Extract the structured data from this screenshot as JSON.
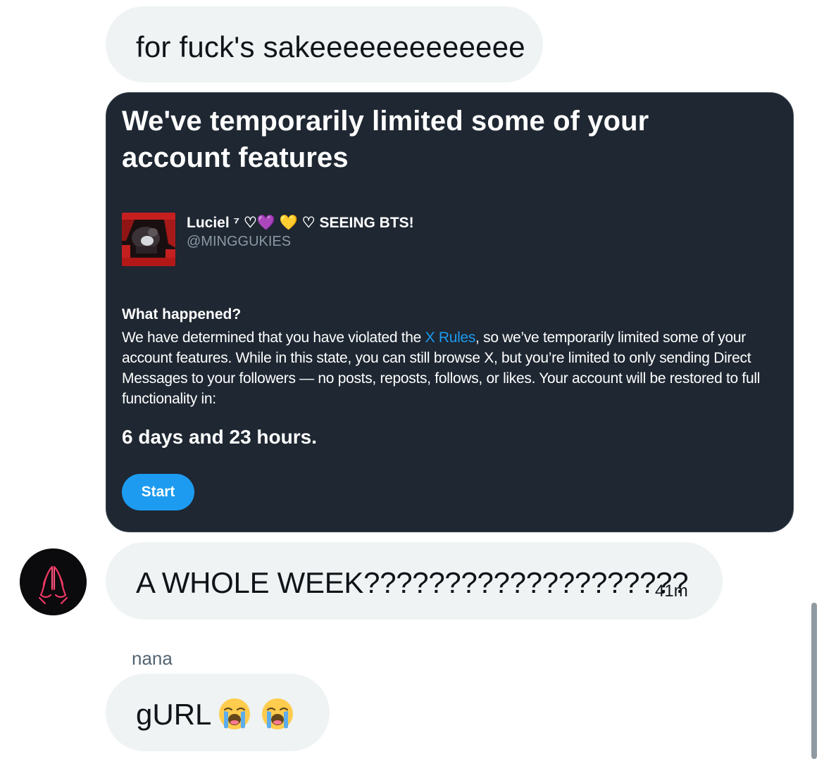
{
  "messages": {
    "first": {
      "text": "for fuck's sakeeeeeeeeeeeee"
    },
    "second": {
      "text": "A WHOLE WEEK????????????????????",
      "timestamp": "41m"
    },
    "third": {
      "sender": "nana",
      "text": "gURL",
      "emoji": "loudly-crying-face"
    }
  },
  "card": {
    "title": "We've temporarily limited some of your account features",
    "profile": {
      "display_name": "Luciel ⁷ ♡💜 💛 ♡ SEEING BTS!",
      "handle": "@MINGGUKIES"
    },
    "what_happened_heading": "What happened?",
    "body_before_link": "We have determined that you have violated the ",
    "link_text": "X Rules",
    "body_after_link": ", so we’ve temporarily limited some of your account features. While in this state, you can still browse X, but you’re limited to only sending Direct Messages to your followers — no posts, reposts, follows, or likes. Your account will be restored to full functionality in:",
    "duration": "6 days and 23 hours.",
    "start_button": "Start"
  },
  "colors": {
    "card_background": "#1e2732",
    "link_blue": "#1d9bf0",
    "bubble_gray": "#eff3f4",
    "muted_text": "#536471"
  },
  "icons": {
    "avatar_icon": "praying-hands-neon-icon"
  }
}
